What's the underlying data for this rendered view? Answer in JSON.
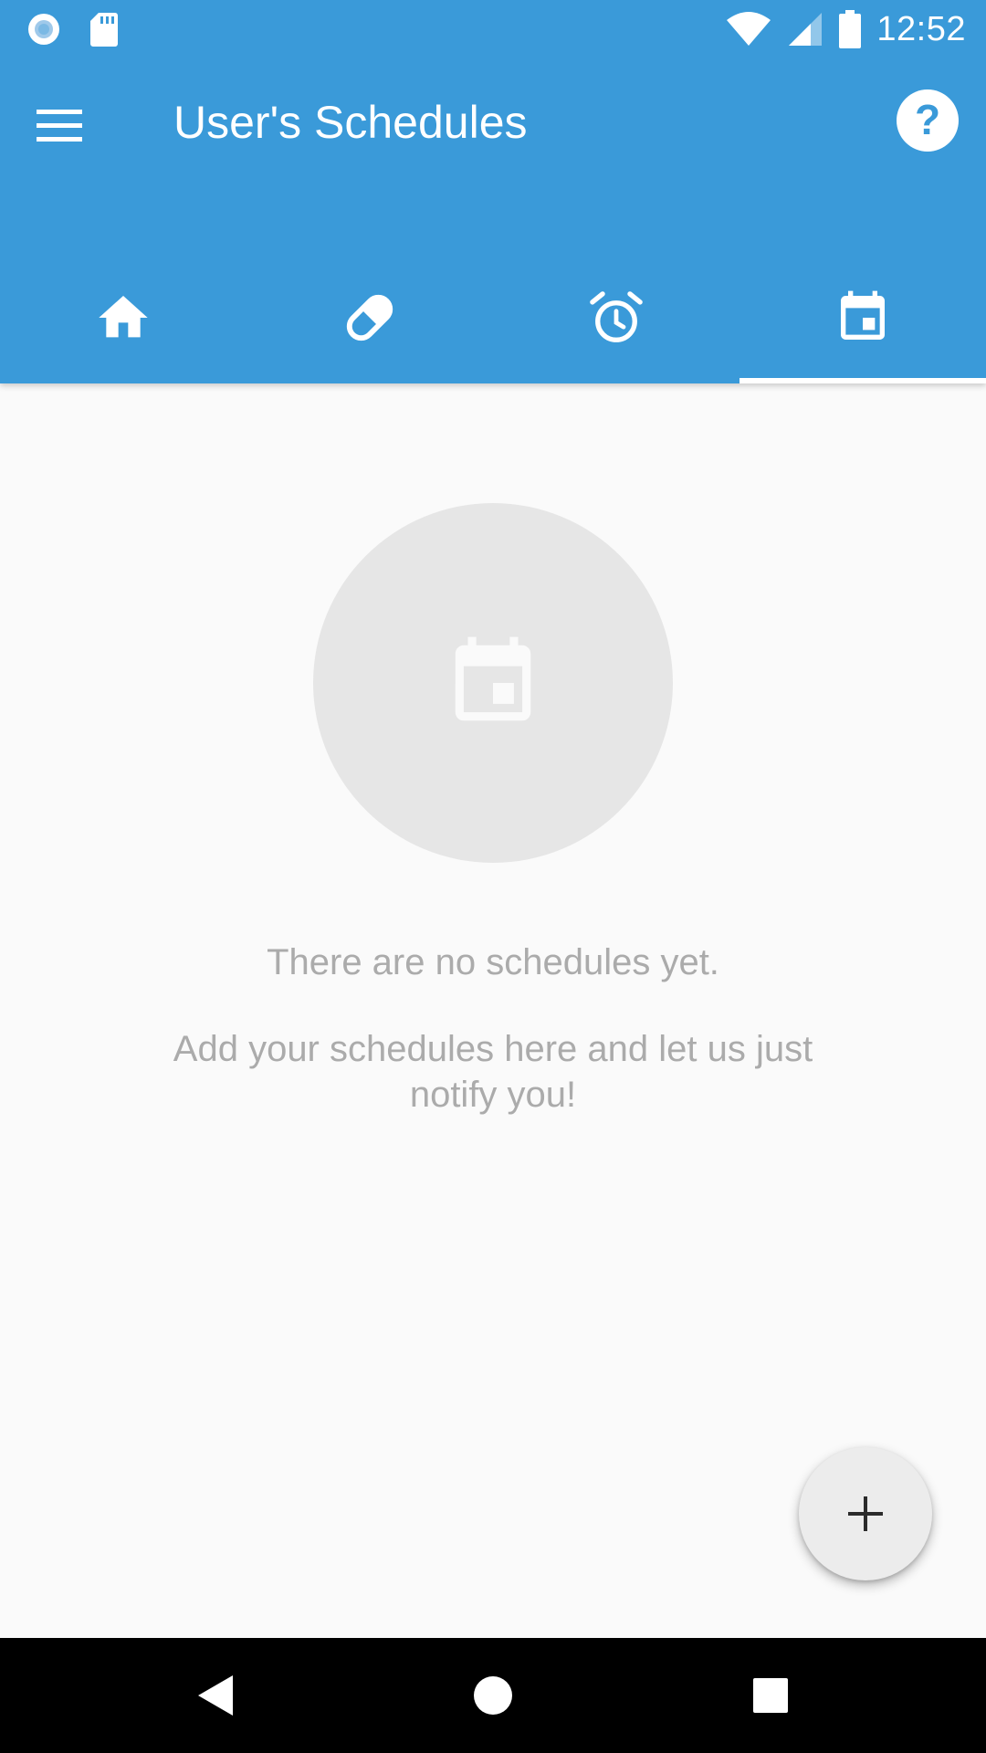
{
  "status_bar": {
    "time": "12:52",
    "icons": [
      "record-icon",
      "sd-card-icon",
      "wifi-icon",
      "cellular-signal-icon",
      "battery-icon"
    ]
  },
  "toolbar": {
    "title": "User's Schedules",
    "menu_icon": "menu-icon",
    "help_icon": "help-icon"
  },
  "tabs": [
    {
      "icon": "home-icon",
      "selected": false
    },
    {
      "icon": "pill-icon",
      "selected": false
    },
    {
      "icon": "alarm-icon",
      "selected": false
    },
    {
      "icon": "calendar-icon",
      "selected": true
    }
  ],
  "empty_state": {
    "icon": "calendar-icon",
    "title": "There are no schedules yet.",
    "subtitle": "Add your schedules here and let us just notify you!"
  },
  "fab": {
    "icon": "plus-icon"
  },
  "nav_bar": {
    "icons": [
      "back-icon",
      "home-circle-icon",
      "recents-icon"
    ]
  },
  "colors": {
    "app_bar": "#3a9ad9",
    "background": "#fafafa",
    "empty_circle": "#e6e6e6",
    "empty_text": "#ababab",
    "fab": "#ececec",
    "nav_bar": "#000000"
  }
}
